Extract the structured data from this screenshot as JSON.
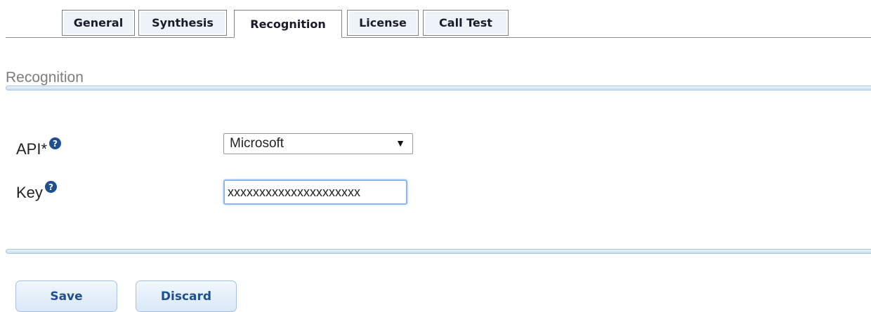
{
  "tabs": [
    {
      "label": "General",
      "active": false
    },
    {
      "label": "Synthesis",
      "active": false
    },
    {
      "label": "Recognition",
      "active": true
    },
    {
      "label": "License",
      "active": false
    },
    {
      "label": "Call Test",
      "active": false
    }
  ],
  "section": {
    "title": "Recognition"
  },
  "form": {
    "api": {
      "label": "API*",
      "help_icon": "question-circle-icon",
      "selected": "Microsoft",
      "arrow": "▼"
    },
    "key": {
      "label": "Key",
      "help_icon": "question-circle-icon",
      "value": "xxxxxxxxxxxxxxxxxxxxx"
    }
  },
  "buttons": {
    "save": "Save",
    "discard": "Discard"
  },
  "colors": {
    "accent": "#1f4f8f",
    "divider": "#c9def2",
    "focus_border": "#8eb6e8"
  }
}
